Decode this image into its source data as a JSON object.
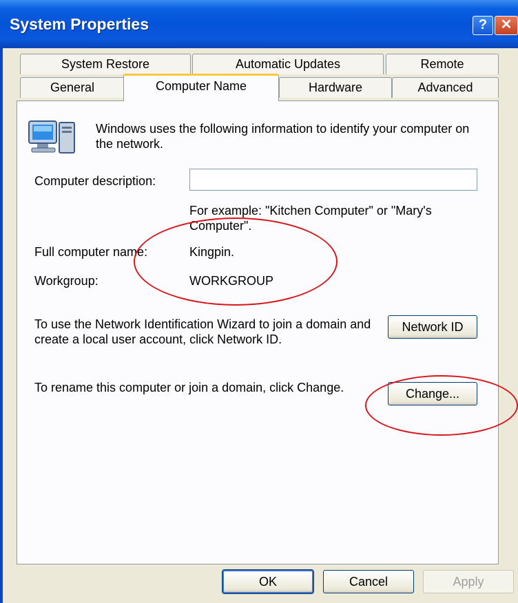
{
  "window": {
    "title": "System Properties"
  },
  "titlebar": {
    "help_glyph": "?",
    "close_glyph": "✕"
  },
  "tabs": {
    "back": [
      "System Restore",
      "Automatic Updates",
      "Remote"
    ],
    "front": [
      "General",
      "Computer Name",
      "Hardware",
      "Advanced"
    ],
    "active": "Computer Name"
  },
  "computer_name": {
    "intro": "Windows uses the following information to identify your computer on the network.",
    "description_label": "Computer description:",
    "description_value": "",
    "example_hint": "For example: \"Kitchen Computer\" or \"Mary's Computer\".",
    "full_name_label": "Full computer name:",
    "full_name_value": "Kingpin.",
    "workgroup_label": "Workgroup:",
    "workgroup_value": "WORKGROUP",
    "network_id_text": "To use the Network Identification Wizard to join a domain and create a local user account, click Network ID.",
    "network_id_button": "Network ID",
    "rename_text": "To rename this computer or join a domain, click Change.",
    "change_button": "Change..."
  },
  "footer": {
    "ok": "OK",
    "cancel": "Cancel",
    "apply": "Apply"
  },
  "colors": {
    "titlebar": "#0453d9",
    "annotation": "#d8151b",
    "tab_highlight": "#ffc73c"
  }
}
